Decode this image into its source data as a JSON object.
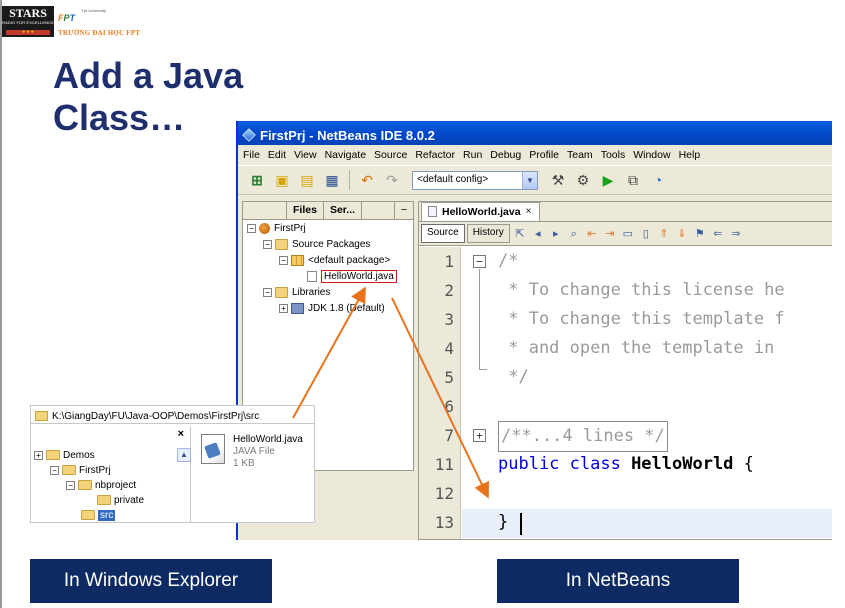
{
  "slide": {
    "title_line1": "Add a Java",
    "title_line2": "Class…",
    "logo_stars_big": "STARS",
    "logo_stars_small": "RADIO FOR EXCELLENCE",
    "logo_fpt_university": "Fpt University",
    "logo_fpt_school": "TRƯỜNG ĐẠI HỌC FPT",
    "caption_explorer": "In Windows Explorer",
    "caption_netbeans": "In NetBeans"
  },
  "netbeans": {
    "window_title": "FirstPrj - NetBeans IDE 8.0.2",
    "menus": [
      "File",
      "Edit",
      "View",
      "Navigate",
      "Source",
      "Refactor",
      "Run",
      "Debug",
      "Profile",
      "Team",
      "Tools",
      "Window",
      "Help"
    ],
    "config_select": "<default config>",
    "project_tabs": [
      "Files",
      "Ser..."
    ],
    "project_tab_close": "−",
    "tree": {
      "project": "FirstPrj",
      "source_packages": "Source Packages",
      "default_package": "<default package>",
      "file": "HelloWorld.java",
      "libraries": "Libraries",
      "jdk": "JDK 1.8 (Default)"
    },
    "editor_tab": "HelloWorld.java",
    "editor_tab_close": "×",
    "view_source": "Source",
    "view_history": "History",
    "code_lines": [
      {
        "n": "1",
        "text": "/*"
      },
      {
        "n": "2",
        "text": " * To change this license he"
      },
      {
        "n": "3",
        "text": " * To change this template f"
      },
      {
        "n": "4",
        "text": " * and open the template in"
      },
      {
        "n": "5",
        "text": " */"
      },
      {
        "n": "6",
        "text": ""
      },
      {
        "n": "7",
        "text": "/**...4 lines */"
      },
      {
        "n": "11",
        "kw": "public class ",
        "cls": "HelloWorld",
        "rest": " {"
      },
      {
        "n": "12",
        "text": ""
      },
      {
        "n": "13",
        "text": "}"
      }
    ]
  },
  "explorer": {
    "address": "K:\\GiangDay\\FU\\Java-OOP\\Demos\\FirstPrj\\src",
    "close": "×",
    "tree": [
      "Demos",
      "FirstPrj",
      "nbproject",
      "private",
      "src"
    ],
    "file_name": "HelloWorld.java",
    "file_type": "JAVA File",
    "file_size": "1 KB"
  },
  "colors": {
    "title": "#1f2f6e",
    "caption_bg": "#0e2a62",
    "arrow": "#e8731c",
    "highlight": "#d01a1a"
  }
}
